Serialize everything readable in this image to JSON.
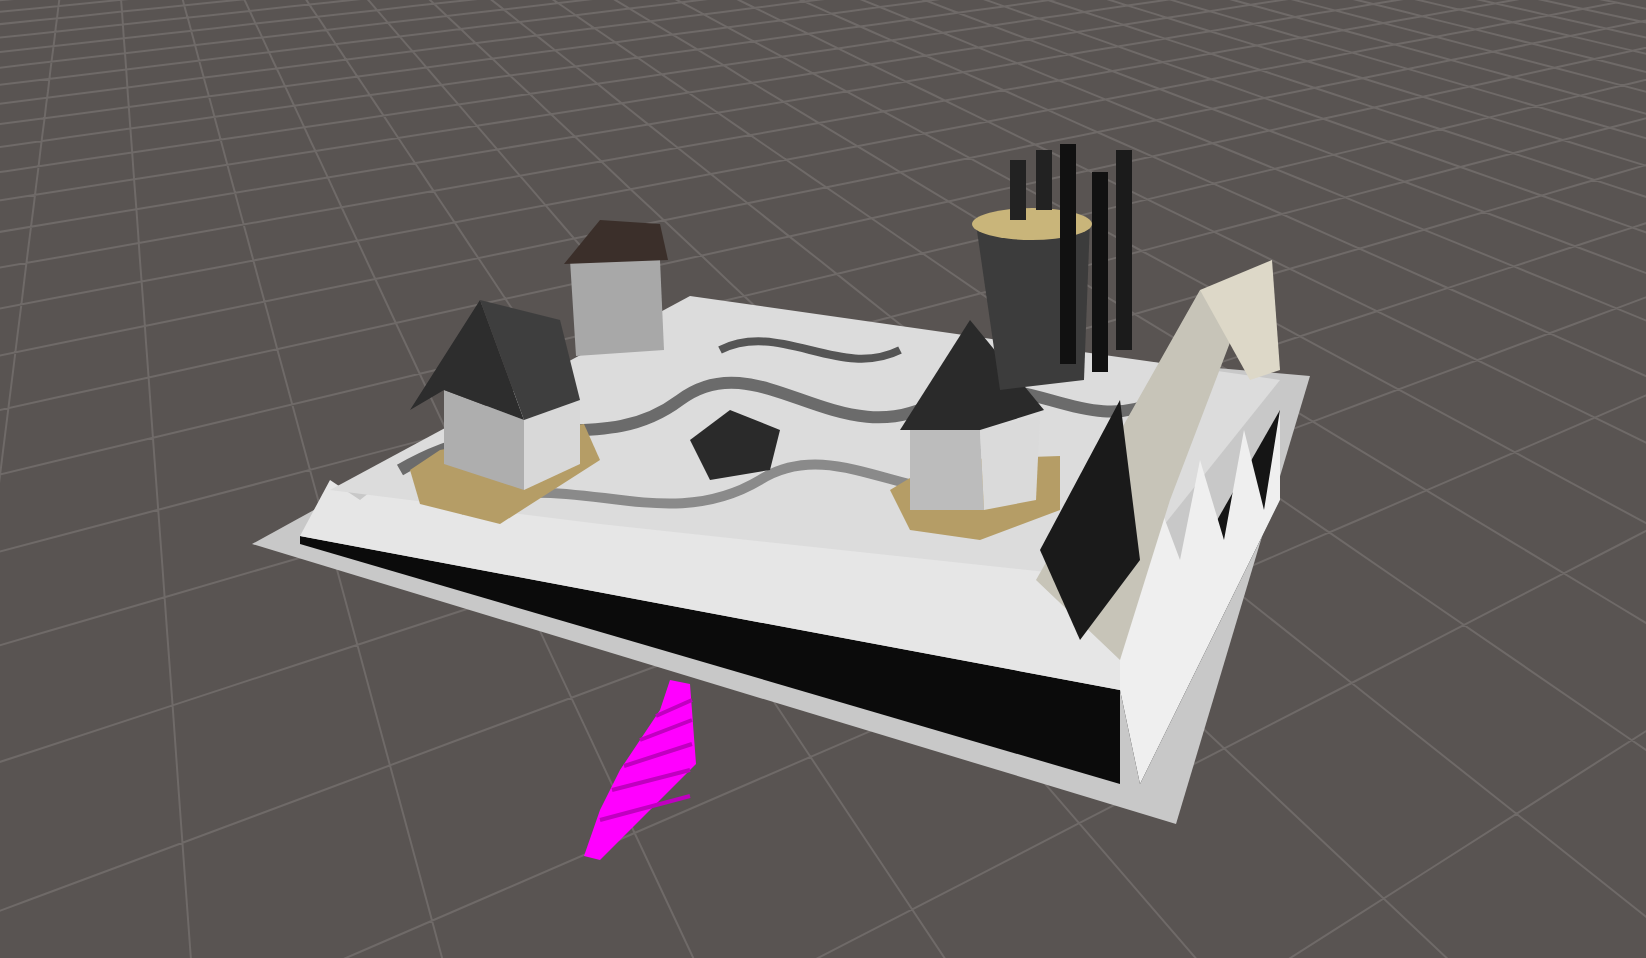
{
  "scene_view": {
    "grid": true
  }
}
